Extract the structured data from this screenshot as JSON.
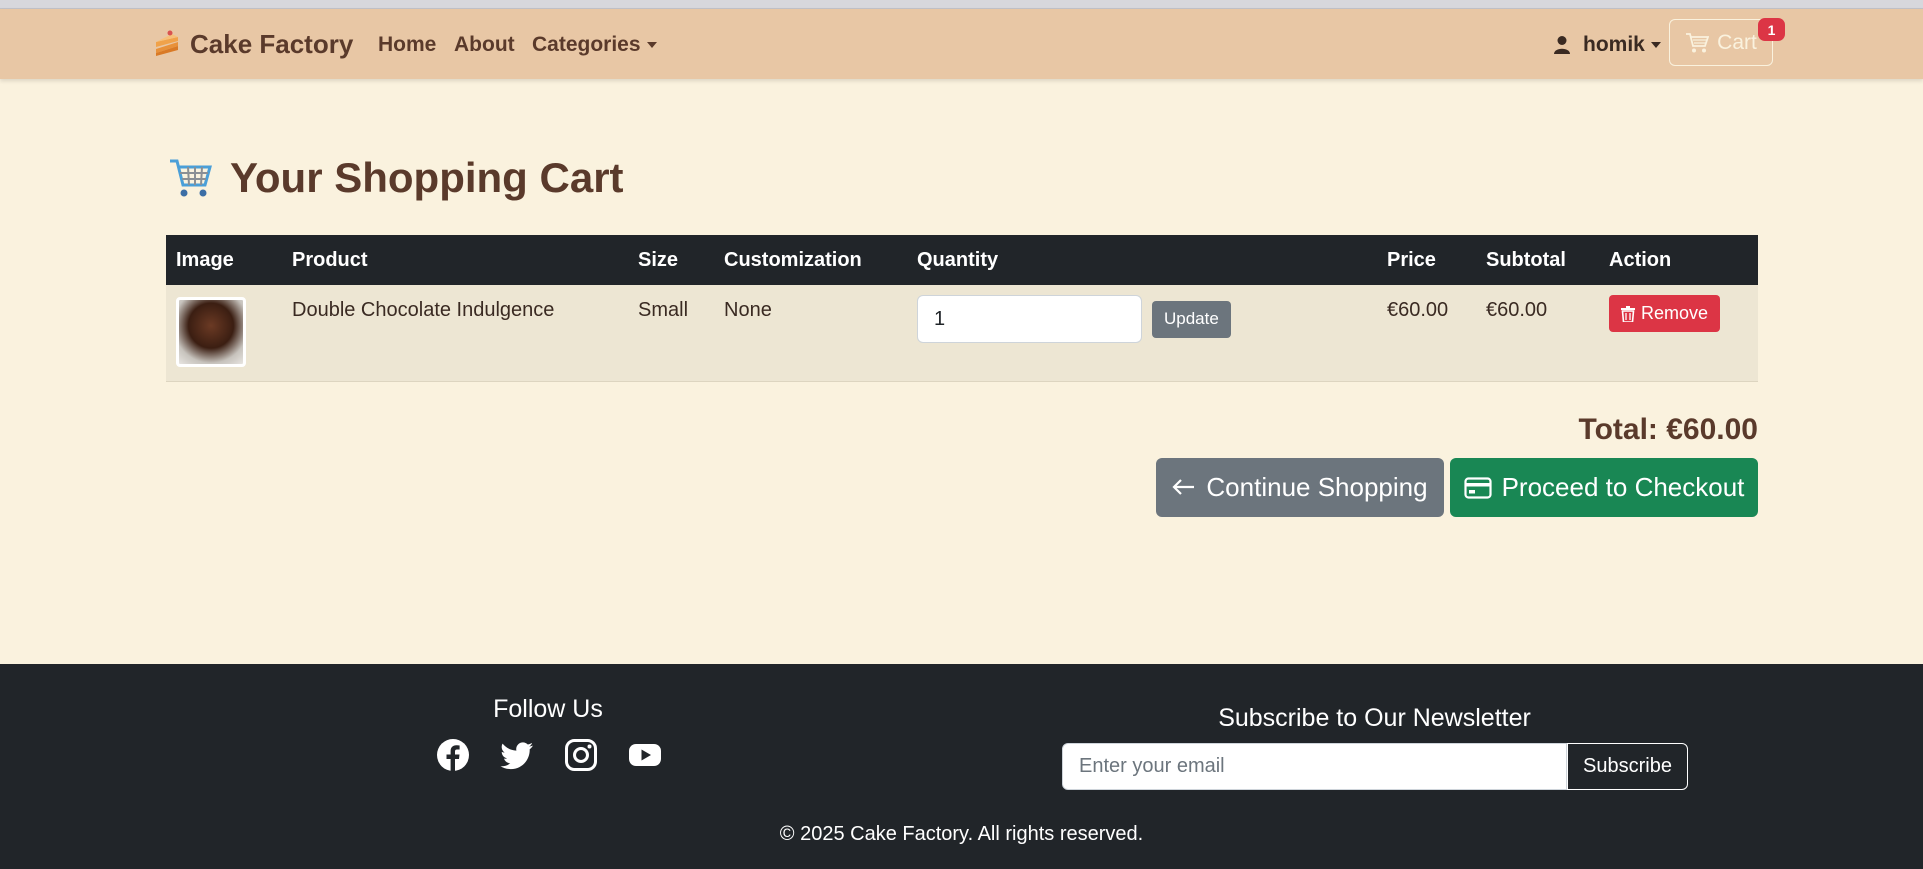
{
  "navbar": {
    "brand": "Cake Factory",
    "links": [
      "Home",
      "About",
      "Categories"
    ],
    "user": "homik",
    "cart_label": "Cart",
    "cart_count": "1",
    "bg_color": "#e8c7a5"
  },
  "page": {
    "title": "Your Shopping Cart"
  },
  "cart": {
    "columns": [
      "Image",
      "Product",
      "Size",
      "Customization",
      "Quantity",
      "Price",
      "Subtotal",
      "Action"
    ],
    "items": [
      {
        "product": "Double Chocolate Indulgence",
        "size": "Small",
        "customization": "None",
        "quantity": "1",
        "price": "€60.00",
        "subtotal": "€60.00",
        "update_label": "Update",
        "remove_label": "Remove"
      }
    ],
    "total": "Total: €60.00",
    "continue_label": "Continue Shopping",
    "checkout_label": "Proceed to Checkout"
  },
  "footer": {
    "follow_title": "Follow Us",
    "socials": [
      "facebook-icon",
      "twitter-icon",
      "instagram-icon",
      "youtube-icon"
    ],
    "newsletter_title": "Subscribe to Our Newsletter",
    "email_placeholder": "Enter your email",
    "subscribe_label": "Subscribe",
    "copyright": "© 2025 Cake Factory. All rights reserved."
  },
  "colors": {
    "page_bg": "#faf2de",
    "dark": "#212529",
    "danger": "#dc3545",
    "success": "#198754",
    "secondary": "#6c757d"
  }
}
